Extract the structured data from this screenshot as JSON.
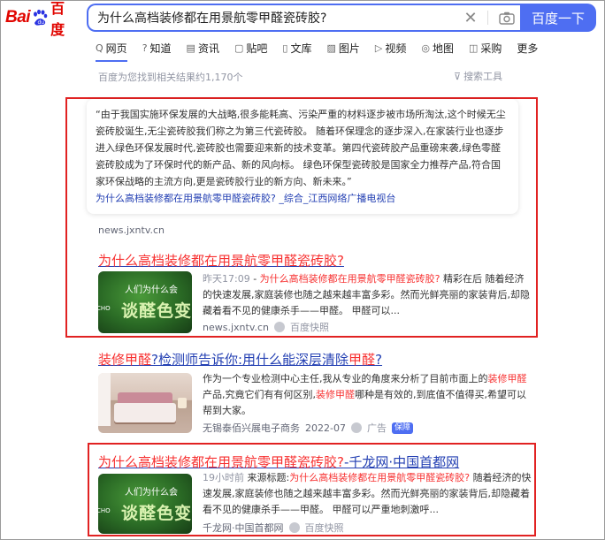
{
  "header": {
    "logo_left": "Bai",
    "logo_right": "百度",
    "query": "为什么高档装修都在用景航零甲醛瓷砖胶?",
    "search_button": "百度一下"
  },
  "tabs": [
    {
      "icon": "Q",
      "label": "网页"
    },
    {
      "icon": "?",
      "label": "知道"
    },
    {
      "icon": "▤",
      "label": "资讯"
    },
    {
      "icon": "▢",
      "label": "贴吧"
    },
    {
      "icon": "▯",
      "label": "文库"
    },
    {
      "icon": "▨",
      "label": "图片"
    },
    {
      "icon": "▷",
      "label": "视频"
    },
    {
      "icon": "◎",
      "label": "地图"
    },
    {
      "icon": "◫",
      "label": "采购"
    },
    {
      "icon": "",
      "label": "更多"
    }
  ],
  "count_text": "百度为您找到相关结果约1,170个",
  "tools_text": "搜索工具",
  "result1": {
    "quote": "“由于我国实施环保发展的大战略,很多能耗高、污染严重的材料逐步被市场所淘汰,这个时候无尘瓷砖胶诞生,无尘瓷砖胶我们称之为第三代瓷砖胶。 随着环保理念的逐步深入,在家装行业也逐步进入绿色环保发展时代,瓷砖胶也需要迎来新的技术变革。第四代瓷砖胶产品重磅来袭,绿色零醛瓷砖胶成为了环保时代的新产品、新的风向标。 绿色环保型瓷砖胶是国家全力推荐产品,符合国家环保战略的主流方向,更是瓷砖胶行业的新方向、新未来。”",
    "quote_link": "为什么高档装修都在用景航零甲醛瓷砖胶? _综合_江西网络广播电视台",
    "source": "news.jxntv.cn"
  },
  "result2": {
    "title": "为什么高档装修都在用景航零甲醛瓷砖胶?",
    "date": "昨天17:09",
    "snip_hl": "为什么高档装修都在用景航零甲醛瓷砖胶?",
    "snip_rest": "精彩在后 随着经济的快速发展,家庭装修也随之越来越丰富多彩。然而光鲜亮丽的家装背后,却隐藏着看不见的健康杀手——甲醛。 甲醛可以...",
    "site": "news.jxntv.cn",
    "snapshot": "百度快照",
    "thumb_top": "人们为什么会",
    "thumb_big": "谈醛色变",
    "thumb_side": "CHO"
  },
  "result3": {
    "title_a": "装修甲醛",
    "title_b": "?检测师告诉你:用什么能深层清除",
    "title_c": "甲醛",
    "title_d": "?",
    "snip_1": "作为一个专业检测中心主任,我从专业的角度来分析了目前市面上的",
    "snip_hl1": "装修甲醛",
    "snip_2": "产品,究竟它们有有何区别,",
    "snip_hl2": "装修甲醛",
    "snip_3": "哪种是有效的,到底值不值得买,希望可以帮到大家。",
    "source": "无锡泰佰兴展电子商务",
    "date": "2022-07",
    "ad": "广告",
    "badge": "保障"
  },
  "result4": {
    "title_hl": "为什么高档装修都在用景航零甲醛瓷砖胶?",
    "title_rest": "-千龙网·中国首都网",
    "date": "19小时前",
    "label": "来源标题:",
    "snip_hl": "为什么高档装修都在用景航零甲醛瓷砖胶?",
    "snip_rest": "随着经济的快速发展,家庭装修也随之越来越丰富多彩。然而光鲜亮丽的家装背后,却隐藏着看不见的健康杀手——甲醛。 甲醛可以严重地刺激呼...",
    "site": "千龙网·中国首都网",
    "snapshot": "百度快照",
    "thumb_top": "人们为什么会",
    "thumb_big": "谈醛色变",
    "thumb_side": "CHO"
  },
  "colors": {
    "accent": "#4e6ef2",
    "link": "#2440b3",
    "highlight": "#f73131",
    "annotation_box": "#e12222"
  }
}
